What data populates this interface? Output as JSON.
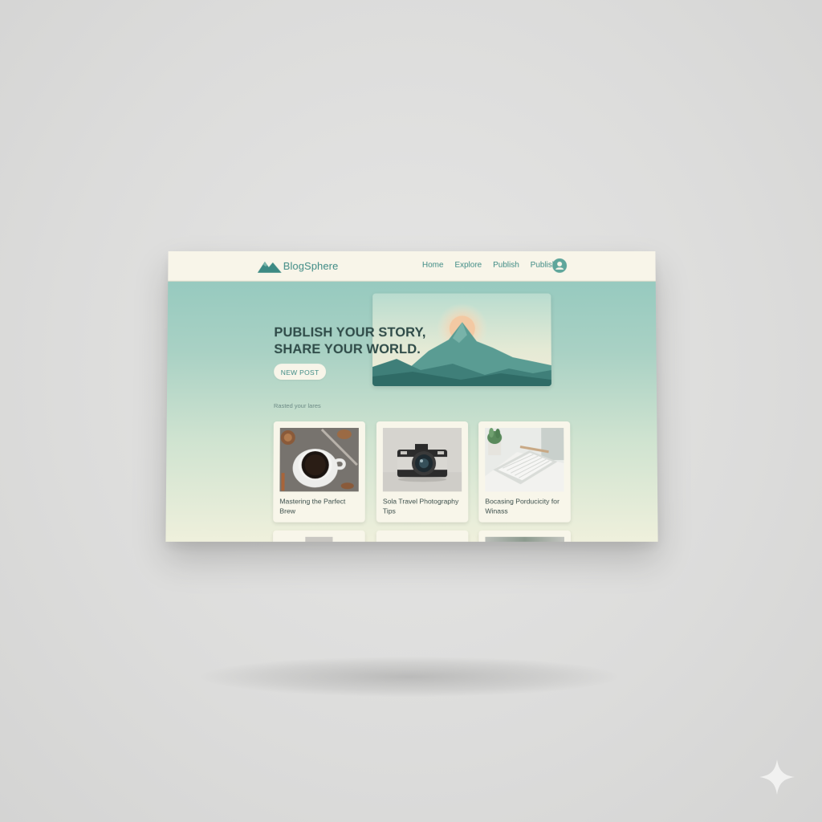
{
  "brand": {
    "name": "BlogSphere"
  },
  "nav": {
    "links": [
      "Home",
      "Explore",
      "Publish",
      "Publish"
    ]
  },
  "hero": {
    "title_line1": "PUBLISH YOUR STORY,",
    "title_line2": "SHARE YOUR WORLD.",
    "cta_label": "NEW POST"
  },
  "section": {
    "label": "Rasted your lares"
  },
  "cards": [
    {
      "title": "Mastering the Parfect Brew"
    },
    {
      "title": "Sola Travel Photography Tips"
    },
    {
      "title": "Bocasing Porducicity for Winass"
    }
  ],
  "colors": {
    "accent": "#3d8a84",
    "nav_background": "#f8f5e9",
    "hero_gradient_top": "#8fc7bd",
    "hero_gradient_bottom": "#eff0dc",
    "heading": "#2f4b48"
  },
  "icons": [
    "mountain-logo-icon",
    "user-avatar-icon",
    "sparkle-icon"
  ]
}
